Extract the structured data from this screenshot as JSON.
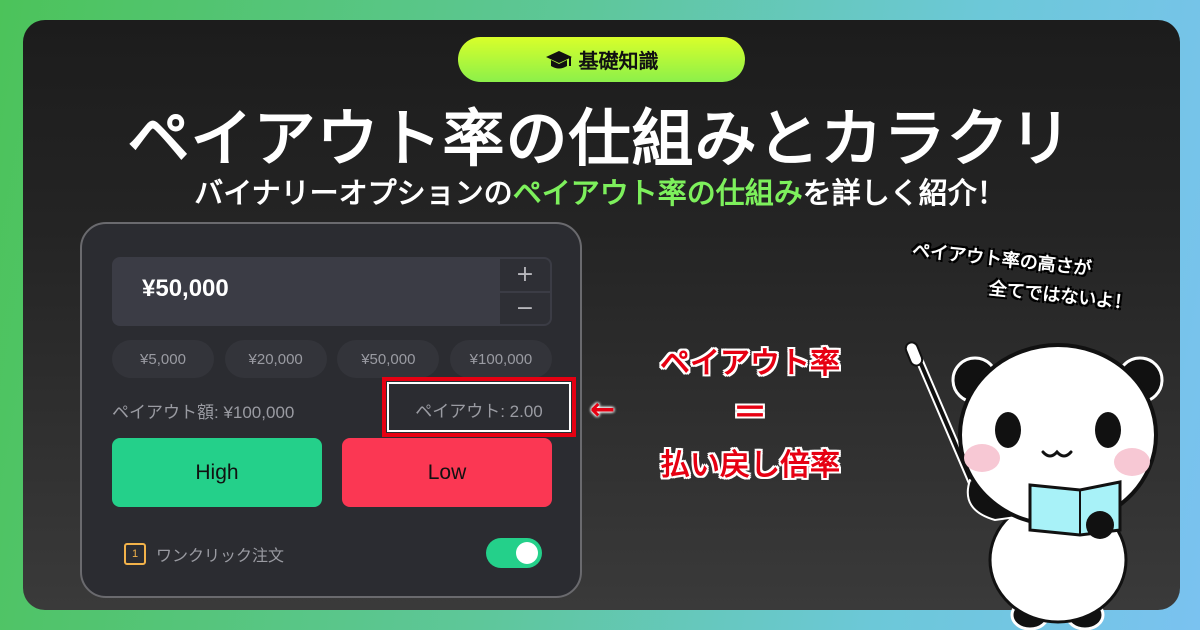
{
  "badge": {
    "icon": "graduation-cap-icon",
    "label": "基礎知識"
  },
  "title": "ペイアウト率の仕組みとカラクリ",
  "subtitle": {
    "prefix": "バイナリーオプションの",
    "highlight": "ペイアウト率の仕組み",
    "suffix": "を詳しく紹介！"
  },
  "widget": {
    "amount": "¥50,000",
    "plus": "+",
    "minus": "−",
    "presets": [
      "¥5,000",
      "¥20,000",
      "¥50,000",
      "¥100,000"
    ],
    "payout_amount": "ペイアウト額: ¥100,000",
    "payout_rate": "ペイアウト: 2.00",
    "high": "High",
    "low": "Low",
    "oneclick_icon": "1",
    "oneclick_label": "ワンクリック注文",
    "oneclick_enabled": true
  },
  "callout": {
    "arrow": "←",
    "line1": "ペイアウト率",
    "equals": "＝",
    "line2": "払い戻し倍率"
  },
  "speech": {
    "line1": "ペイアウト率の高さが",
    "line2": "全てではないよ！"
  },
  "colors": {
    "high": "#24d08a",
    "low": "#fb3753",
    "highlight": "#7df05c",
    "callout": "#e60012",
    "badge": "#b8f53a"
  }
}
